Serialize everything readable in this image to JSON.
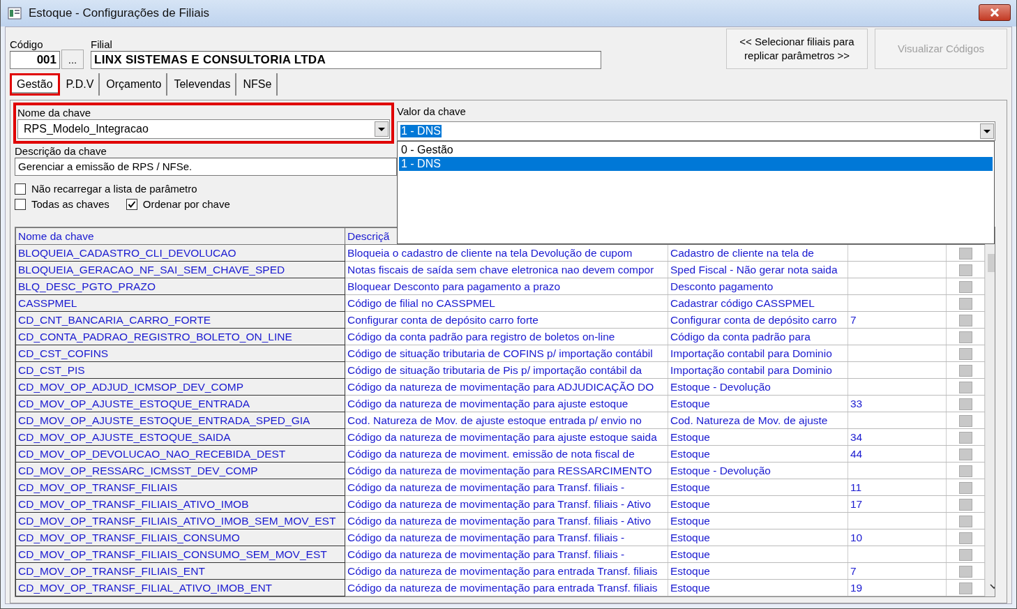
{
  "window": {
    "title": "Estoque - Configurações de Filiais"
  },
  "header": {
    "code_label": "Código",
    "code": "001",
    "browse_button": "...",
    "branch_label": "Filial",
    "branch": "LINX SISTEMAS E CONSULTORIA LTDA"
  },
  "actions": [
    {
      "label": "<< Selecionar filiais para replicar parâmetros >>",
      "disabled": false
    },
    {
      "label": "Visualizar Códigos",
      "disabled": true
    }
  ],
  "tabs": [
    {
      "label": "Gestão",
      "selected": true,
      "highlighted": true
    },
    {
      "label": "P.D.V",
      "selected": false,
      "highlighted": false
    },
    {
      "label": "Orçamento",
      "selected": false,
      "highlighted": false
    },
    {
      "label": "Televendas",
      "selected": false,
      "highlighted": false
    },
    {
      "label": "NFSe",
      "selected": false,
      "highlighted": false
    }
  ],
  "key_name": {
    "label": "Nome da chave",
    "value": "RPS_Modelo_Integracao",
    "highlighted": true
  },
  "key_value": {
    "label": "Valor da chave",
    "value": "1 - DNS",
    "options": [
      {
        "label": "0 - Gestão",
        "selected": false
      },
      {
        "label": "1 - DNS",
        "selected": true
      }
    ]
  },
  "key_description": {
    "label": "Descrição da chave",
    "value": "Gerenciar a emissão de RPS / NFSe."
  },
  "options": [
    {
      "label": "Não recarregar a lista de parâmetro",
      "checked": false
    },
    {
      "label": "Todas as chaves",
      "checked": false
    },
    {
      "label": "Ordenar por chave",
      "checked": true
    }
  ],
  "table": {
    "columns": [
      "Nome da chave",
      "Descriçã"
    ],
    "rows": [
      {
        "name": "BLOQUEIA_CADASTRO_CLI_DEVOLUCAO",
        "description": "Bloqueia o cadastro de cliente na tela Devolução de cupom",
        "column_3": "Cadastro de cliente na tela de"
      },
      {
        "name": "BLOQUEIA_GERACAO_NF_SAI_SEM_CHAVE_SPED",
        "description": "Notas fiscais de saída sem chave eletronica nao devem compor",
        "column_3": "Sped Fiscal - Não gerar nota saida"
      },
      {
        "name": "BLQ_DESC_PGTO_PRAZO",
        "description": "Bloquear Desconto para pagamento a prazo",
        "column_3": "Desconto pagamento"
      },
      {
        "name": "CASSPMEL",
        "description": "Código de filial no CASSPMEL",
        "column_3": "Cadastrar código CASSPMEL"
      },
      {
        "name": "CD_CNT_BANCARIA_CARRO_FORTE",
        "description": "Configurar conta de depósito carro forte",
        "column_3": "Configurar conta de depósito carro",
        "column_4": "7"
      },
      {
        "name": "CD_CONTA_PADRAO_REGISTRO_BOLETO_ON_LINE",
        "description": "Código da conta padrão para registro de boletos on-line",
        "column_3": "Código da conta padrão para"
      },
      {
        "name": "CD_CST_COFINS",
        "description": "Código de situação tributaria de COFINS  p/ importação contábil",
        "column_3": "Importação contabil para Dominio"
      },
      {
        "name": "CD_CST_PIS",
        "description": "Código de situação tributaria de Pis  p/ importação contábil da",
        "column_3": "Importação contabil para Dominio"
      },
      {
        "name": "CD_MOV_OP_ADJUD_ICMSOP_DEV_COMP",
        "description": "Código da natureza de movimentação para ADJUDICAÇÃO DO",
        "column_3": "Estoque - Devolução"
      },
      {
        "name": "CD_MOV_OP_AJUSTE_ESTOQUE_ENTRADA",
        "description": "Código da natureza de movimentação para ajuste estoque",
        "column_3": "Estoque",
        "column_4": "33"
      },
      {
        "name": "CD_MOV_OP_AJUSTE_ESTOQUE_ENTRADA_SPED_GIA",
        "description": "Cod. Natureza de Mov. de ajuste estoque entrada p/ envio no",
        "column_3": "Cod. Natureza de Mov. de ajuste"
      },
      {
        "name": "CD_MOV_OP_AJUSTE_ESTOQUE_SAIDA",
        "description": "Código da natureza de movimentação para ajuste estoque saida",
        "column_3": "Estoque",
        "column_4": "34"
      },
      {
        "name": "CD_MOV_OP_DEVOLUCAO_NAO_RECEBIDA_DEST",
        "description": "Código da natureza de moviment. emissão de nota fiscal de",
        "column_3": "Estoque",
        "column_4": "44"
      },
      {
        "name": "CD_MOV_OP_RESSARC_ICMSST_DEV_COMP",
        "description": "Código da natureza de movimentação para RESSARCIMENTO",
        "column_3": "Estoque - Devolução"
      },
      {
        "name": "CD_MOV_OP_TRANSF_FILIAIS",
        "description": "Código da natureza de movimentação para Transf. filiais -",
        "column_3": "Estoque",
        "column_4": "11"
      },
      {
        "name": "CD_MOV_OP_TRANSF_FILIAIS_ATIVO_IMOB",
        "description": "Código da natureza de movimentação para Transf. filiais - Ativo",
        "column_3": "Estoque",
        "column_4": "17"
      },
      {
        "name": "CD_MOV_OP_TRANSF_FILIAIS_ATIVO_IMOB_SEM_MOV_EST",
        "description": "Código da natureza de movimentação para Transf. filiais - Ativo",
        "column_3": "Estoque"
      },
      {
        "name": "CD_MOV_OP_TRANSF_FILIAIS_CONSUMO",
        "description": "Código da natureza de movimentação para Transf. filiais -",
        "column_3": "Estoque",
        "column_4": "10"
      },
      {
        "name": "CD_MOV_OP_TRANSF_FILIAIS_CONSUMO_SEM_MOV_EST",
        "description": "Código da natureza de movimentação para Transf. filiais -",
        "column_3": "Estoque"
      },
      {
        "name": "CD_MOV_OP_TRANSF_FILIAIS_ENT",
        "description": "Código da natureza de movimentação para entrada Transf. filiais",
        "column_3": "Estoque",
        "column_4": "7"
      },
      {
        "name": "CD_MOV_OP_TRANSF_FILIAL_ATIVO_IMOB_ENT",
        "description": "Código da natureza de movimentação para entrada Transf. filiais",
        "column_3": "Estoque",
        "column_4": "19"
      }
    ]
  }
}
